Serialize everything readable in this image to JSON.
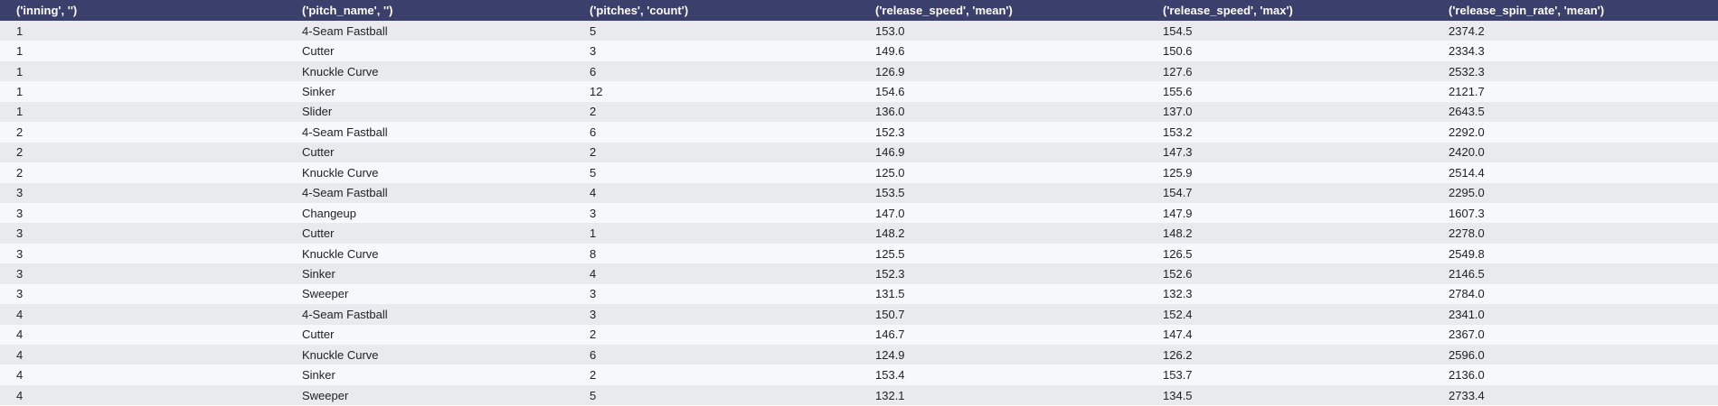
{
  "table": {
    "columns": [
      "('inning', '')",
      "('pitch_name', '')",
      "('pitches', 'count')",
      "('release_speed', 'mean')",
      "('release_speed', 'max')",
      "('release_spin_rate', 'mean')"
    ],
    "rows": [
      [
        "1",
        "4-Seam Fastball",
        "5",
        "153.0",
        "154.5",
        "2374.2"
      ],
      [
        "1",
        "Cutter",
        "3",
        "149.6",
        "150.6",
        "2334.3"
      ],
      [
        "1",
        "Knuckle Curve",
        "6",
        "126.9",
        "127.6",
        "2532.3"
      ],
      [
        "1",
        "Sinker",
        "12",
        "154.6",
        "155.6",
        "2121.7"
      ],
      [
        "1",
        "Slider",
        "2",
        "136.0",
        "137.0",
        "2643.5"
      ],
      [
        "2",
        "4-Seam Fastball",
        "6",
        "152.3",
        "153.2",
        "2292.0"
      ],
      [
        "2",
        "Cutter",
        "2",
        "146.9",
        "147.3",
        "2420.0"
      ],
      [
        "2",
        "Knuckle Curve",
        "5",
        "125.0",
        "125.9",
        "2514.4"
      ],
      [
        "3",
        "4-Seam Fastball",
        "4",
        "153.5",
        "154.7",
        "2295.0"
      ],
      [
        "3",
        "Changeup",
        "3",
        "147.0",
        "147.9",
        "1607.3"
      ],
      [
        "3",
        "Cutter",
        "1",
        "148.2",
        "148.2",
        "2278.0"
      ],
      [
        "3",
        "Knuckle Curve",
        "8",
        "125.5",
        "126.5",
        "2549.8"
      ],
      [
        "3",
        "Sinker",
        "4",
        "152.3",
        "152.6",
        "2146.5"
      ],
      [
        "3",
        "Sweeper",
        "3",
        "131.5",
        "132.3",
        "2784.0"
      ],
      [
        "4",
        "4-Seam Fastball",
        "3",
        "150.7",
        "152.4",
        "2341.0"
      ],
      [
        "4",
        "Cutter",
        "2",
        "146.7",
        "147.4",
        "2367.0"
      ],
      [
        "4",
        "Knuckle Curve",
        "6",
        "124.9",
        "126.2",
        "2596.0"
      ],
      [
        "4",
        "Sinker",
        "2",
        "153.4",
        "153.7",
        "2136.0"
      ],
      [
        "4",
        "Sweeper",
        "5",
        "132.1",
        "134.5",
        "2733.4"
      ]
    ]
  },
  "colors": {
    "header_bg": "#3b3f6b",
    "header_text": "#ffffff",
    "row_odd": "#e9eaee",
    "row_even": "#f7f8fc"
  }
}
